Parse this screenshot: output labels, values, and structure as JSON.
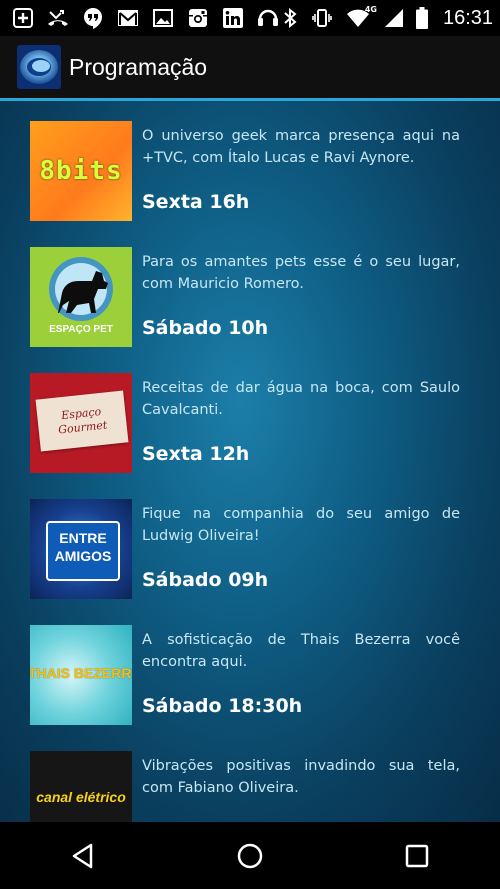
{
  "status_bar": {
    "time": "16:31",
    "network": "4G",
    "left_icons": [
      "add-icon",
      "missed-call-icon",
      "hangouts-icon",
      "gmail-icon",
      "gallery-icon",
      "instagram-icon",
      "linkedin-icon",
      "headset-icon"
    ],
    "right_icons": [
      "bluetooth-icon",
      "vibrate-icon",
      "wifi-icon",
      "signal-icon",
      "battery-icon"
    ]
  },
  "app_bar": {
    "title": "Programação",
    "accent_color": "#2aa7d8"
  },
  "programs": [
    {
      "thumb": "8bits",
      "thumb_text": "8bits",
      "description": "O universo geek marca presença aqui na +TVC, com Ítalo Lucas e Ravi Aynore.",
      "schedule": "Sexta 16h"
    },
    {
      "thumb": "espaco-pet",
      "thumb_text": "ESPAÇO PET",
      "description": "Para os amantes pets esse é o seu lugar, com Mauricio Romero.",
      "schedule": "Sábado 10h"
    },
    {
      "thumb": "espaco-gourmet",
      "thumb_text": "Espaço Gourmet",
      "description": "Receitas de dar água na boca, com Saulo Cavalcanti.",
      "schedule": "Sexta 12h"
    },
    {
      "thumb": "entre-amigos",
      "thumb_text": "ENTRE AMIGOS",
      "description": "Fique na companhia do seu amigo de Ludwig Oliveira!",
      "schedule": "Sábado 09h"
    },
    {
      "thumb": "thais-bezerra",
      "thumb_text": "THAIS BEZERRA",
      "description": "A sofisticação de Thais Bezerra você encontra aqui.",
      "schedule": "Sábado 18:30h"
    },
    {
      "thumb": "canal-eletrico",
      "thumb_text": "canal elétrico",
      "description": "Vibrações positivas invadindo sua tela, com Fabiano Oliveira.",
      "schedule": ""
    }
  ],
  "nav_bar": {
    "buttons": [
      "back-icon",
      "home-icon",
      "recents-icon"
    ]
  }
}
